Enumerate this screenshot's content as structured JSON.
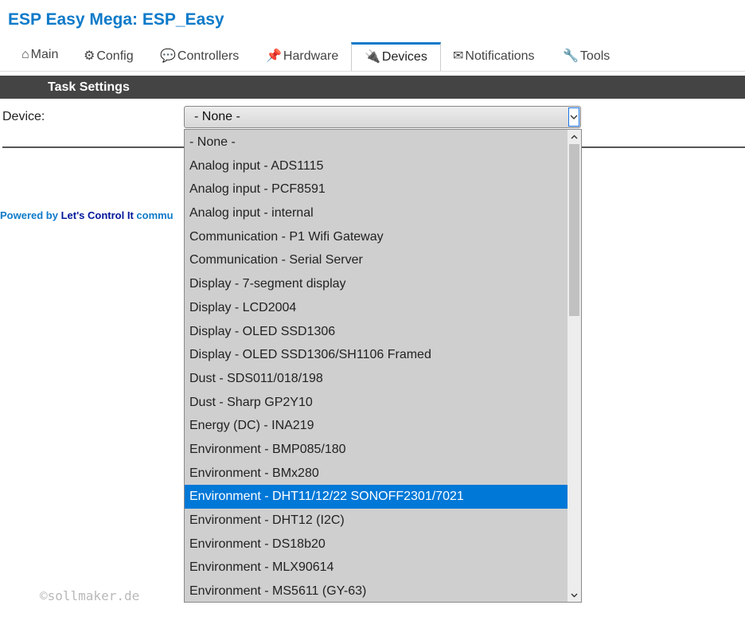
{
  "header": {
    "title": "ESP Easy Mega: ESP_Easy"
  },
  "tabs": [
    {
      "label": "Main",
      "icon": "⌂",
      "icon_name": "home-icon"
    },
    {
      "label": "Config",
      "icon": "⚙",
      "icon_name": "gear-icon"
    },
    {
      "label": "Controllers",
      "icon": "💬",
      "icon_name": "speech-bubble-icon"
    },
    {
      "label": "Hardware",
      "icon": "📌",
      "icon_name": "pin-icon"
    },
    {
      "label": "Devices",
      "icon": "🔌",
      "icon_name": "plug-icon",
      "active": true
    },
    {
      "label": "Notifications",
      "icon": "✉",
      "icon_name": "envelope-icon"
    },
    {
      "label": "Tools",
      "icon": "🔧",
      "icon_name": "wrench-icon"
    }
  ],
  "section_bar": {
    "title": "Task Settings"
  },
  "device_field": {
    "label": "Device:",
    "selected_value": "- None -"
  },
  "footer": {
    "prefix": "Powered by ",
    "brand": "Let's Control It",
    "suffix": " commu"
  },
  "dropdown": {
    "options": [
      "- None -",
      "Analog input - ADS1115",
      "Analog input - PCF8591",
      "Analog input - internal",
      "Communication - P1 Wifi Gateway",
      "Communication - Serial Server",
      "Display - 7-segment display",
      "Display - LCD2004",
      "Display - OLED SSD1306",
      "Display - OLED SSD1306/SH1106 Framed",
      "Dust - SDS011/018/198",
      "Dust - Sharp GP2Y10",
      "Energy (DC) - INA219",
      "Environment - BMP085/180",
      "Environment - BMx280",
      "Environment - DHT11/12/22 SONOFF2301/7021",
      "Environment - DHT12 (I2C)",
      "Environment - DS18b20",
      "Environment - MLX90614",
      "Environment - MS5611 (GY-63)"
    ],
    "highlighted_option": "Environment - DHT11/12/22 SONOFF2301/7021"
  },
  "watermark": "©sollmaker.de",
  "colors": {
    "accent": "#0d7ac9",
    "highlight": "#0078d7",
    "section_bar": "#444444",
    "dropdown_bg": "#cfcfcf"
  }
}
